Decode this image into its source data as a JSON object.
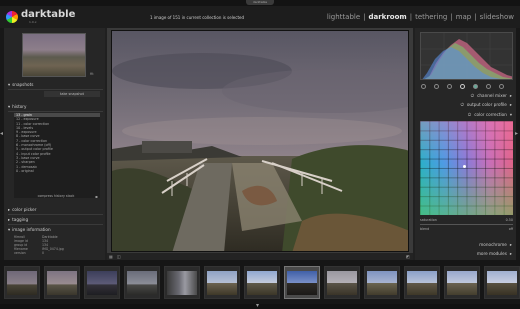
{
  "window": {
    "tab_label": "darktable"
  },
  "header": {
    "app_name": "darktable",
    "version": "1.0.x",
    "status_text": "1 image of 151 in current collection is selected",
    "views": [
      {
        "label": "lighttable",
        "active": false
      },
      {
        "label": "darkroom",
        "active": true
      },
      {
        "label": "tethering",
        "active": false
      },
      {
        "label": "map",
        "active": false
      },
      {
        "label": "slideshow",
        "active": false
      }
    ],
    "view_separator": "|"
  },
  "left_panel": {
    "zoom_label": "fit",
    "snapshots": {
      "title": "snapshots",
      "button_label": "take snapshot"
    },
    "history": {
      "title": "history",
      "items": [
        "13 - grain",
        "12 - exposure",
        "11 - color correction",
        "10 - levels",
        "9 - exposure",
        "8 - base curve",
        "7 - color correction",
        "6 - monochrome (off)",
        "5 - output color profile",
        "4 - input color profile",
        "3 - base curve",
        "2 - sharpen",
        "1 - demosaic",
        "0 - original"
      ],
      "selected_index": 0,
      "compress_label": "compress history stack"
    },
    "color_picker_label": "color picker",
    "tagging_label": "tagging",
    "image_information": {
      "title": "image information",
      "rows": [
        {
          "key": "filmroll",
          "value": "Darktable"
        },
        {
          "key": "image id",
          "value": "134"
        },
        {
          "key": "group id",
          "value": "134"
        },
        {
          "key": "filename",
          "value": "IMG_0474.jpg"
        },
        {
          "key": "version",
          "value": "0"
        }
      ]
    }
  },
  "right_panel": {
    "module_rows": [
      {
        "label": "channel mixer"
      },
      {
        "label": "output color profile"
      },
      {
        "label": "color correction"
      }
    ],
    "sliders": [
      {
        "label": "saturation",
        "value": "0.50"
      },
      {
        "label": "blend",
        "value": "off"
      }
    ],
    "bottom_rows": [
      {
        "label": "monochrome"
      },
      {
        "label": "more modules"
      }
    ],
    "accent_color": "#e8e8e8"
  },
  "filmstrip": {
    "frame_count": 13,
    "selected_index": 7
  },
  "icons": {
    "expand": "triangle-down-icon",
    "collapse": "triangle-right-icon",
    "left_toggle": "triangle-left-icon",
    "right_toggle": "triangle-right-icon",
    "bottom_toggle": "triangle-down-icon"
  }
}
